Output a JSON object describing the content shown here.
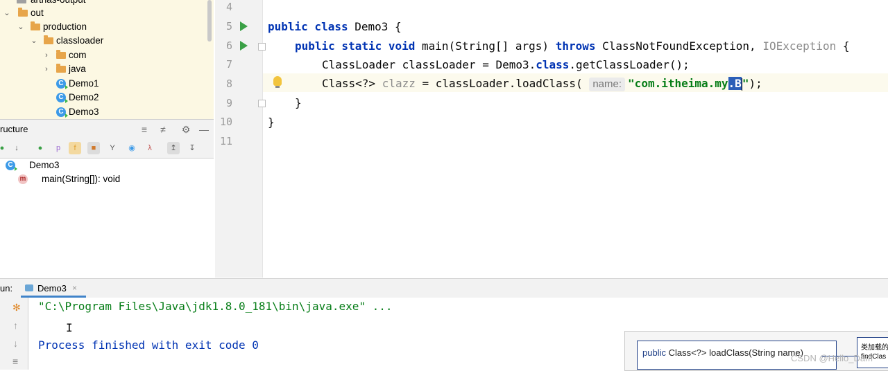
{
  "project_tree": {
    "items": [
      {
        "label": "arthas-output",
        "level": 1
      },
      {
        "label": "out",
        "level": 0
      },
      {
        "label": "production",
        "level": 1
      },
      {
        "label": "classloader",
        "level": 2
      },
      {
        "label": "com",
        "level": 3
      },
      {
        "label": "java",
        "level": 3
      },
      {
        "label": "Demo1",
        "level": 3
      },
      {
        "label": "Demo2",
        "level": 3
      },
      {
        "label": "Demo3",
        "level": 3
      }
    ]
  },
  "structure": {
    "title": "ructure",
    "class_name": "Demo3",
    "method_name": "main(String[]): void"
  },
  "editor": {
    "line_numbers": [
      "4",
      "5",
      "6",
      "7",
      "8",
      "9",
      "10",
      "11"
    ],
    "lines": {
      "l5_kw": "public class ",
      "l5_rest": "Demo3 {",
      "l6_kw": "public static void ",
      "l6_mid": "main(String[] args) ",
      "l6_throws": "throws ",
      "l6_exc": "ClassNotFoundException, ",
      "l6_io": "IOException",
      "l6_end": " {",
      "l7_a": "ClassLoader classLoader = Demo3.",
      "l7_class": "class",
      "l7_b": ".getClassLoader();",
      "l8_a": "Class<?> ",
      "l8_var": "clazz",
      "l8_b": " = classLoader.loadClass(",
      "l8_hint": "name:",
      "l8_str1": "\"com.itheima.my",
      "l8_sel": ".B",
      "l8_str2": "\"",
      "l8_end": ");",
      "l9": "}",
      "l10": "}"
    }
  },
  "run_panel": {
    "label": "un:",
    "tab_label": "Demo3",
    "tab_close": "×",
    "console_lines": [
      "\"C:\\Program Files\\Java\\jdk1.8.0_181\\bin\\java.exe\" ...",
      "Process finished with exit code 0"
    ]
  },
  "popup": {
    "keyword": "public",
    "signature": " Class<?> loadClass(String name)",
    "note_line1": "类加载的",
    "note_line2": "findClas"
  },
  "watermark": "CSDN @Hello_Dam",
  "colors": {
    "keyword": "#0033b3",
    "string": "#067d17",
    "project_bg": "#fcf8e3",
    "selection": "#2c5fb8"
  }
}
